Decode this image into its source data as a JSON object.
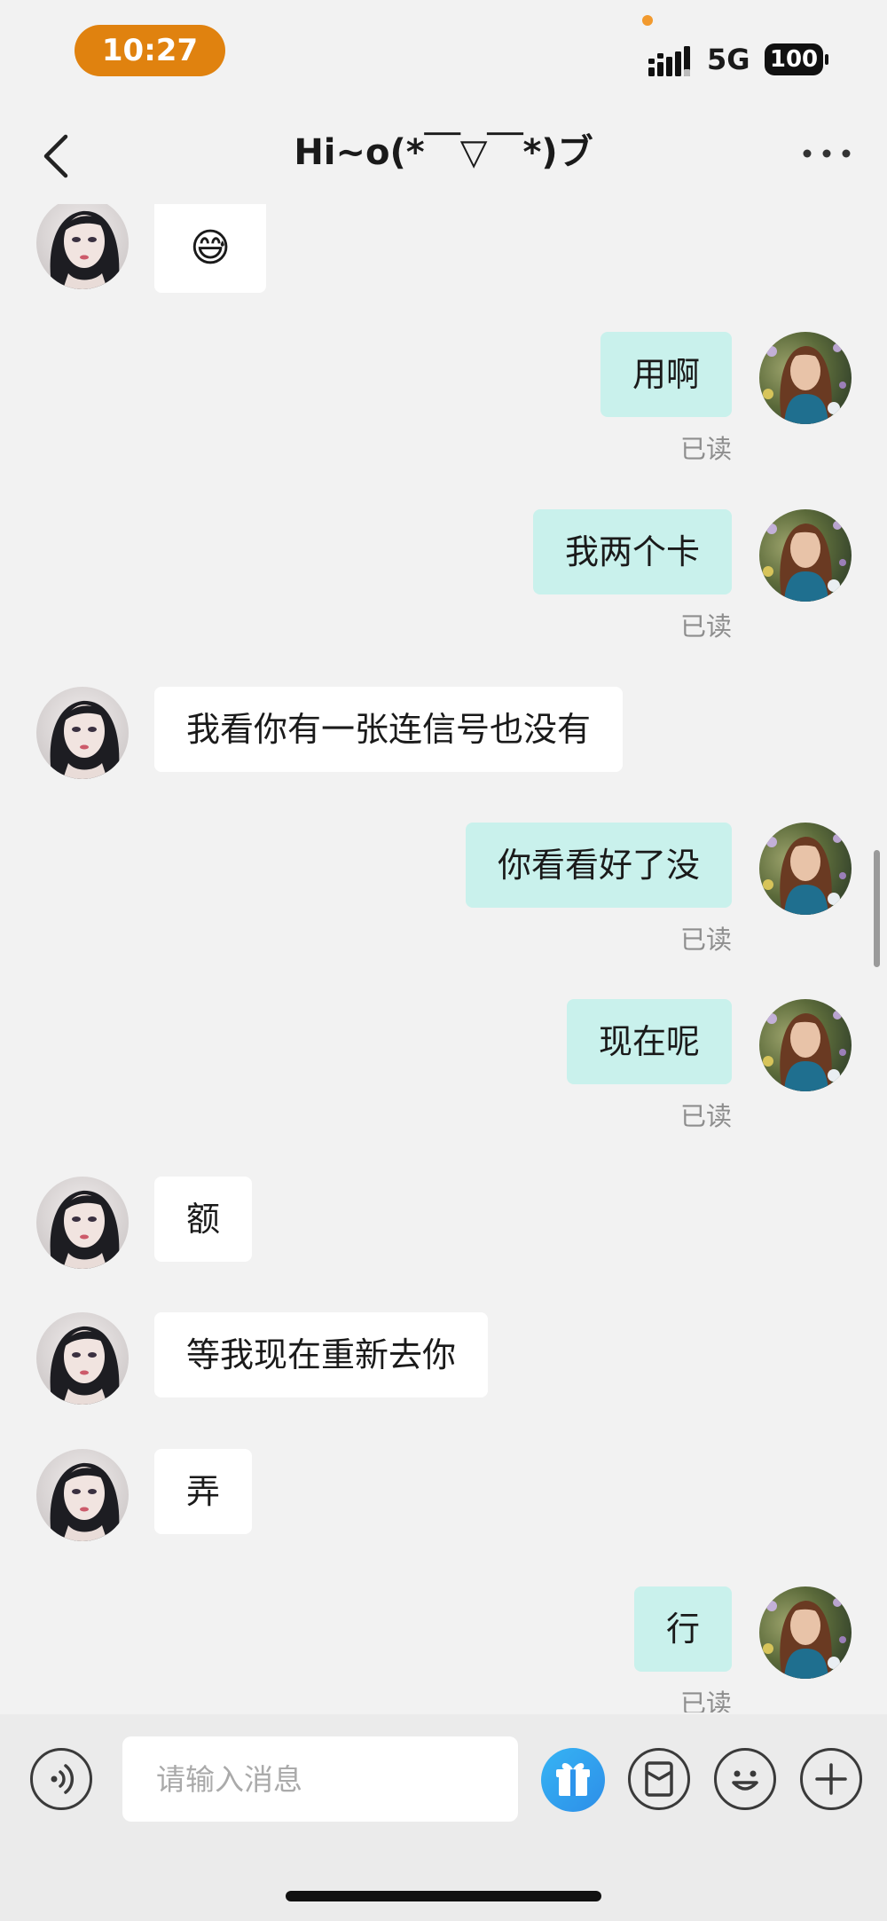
{
  "status_bar": {
    "time": "10:27",
    "network": "5G",
    "battery": "100"
  },
  "header": {
    "title": "Hi~o(*￣▽￣*)ブ"
  },
  "messages": [
    {
      "direction": "in",
      "text": "😅"
    },
    {
      "direction": "out",
      "text": "用啊",
      "status": "已读"
    },
    {
      "direction": "out",
      "text": "我两个卡",
      "status": "已读"
    },
    {
      "direction": "in",
      "text": "我看你有一张连信号也没有"
    },
    {
      "direction": "out",
      "text": "你看看好了没",
      "status": "已读"
    },
    {
      "direction": "out",
      "text": "现在呢",
      "status": "已读"
    },
    {
      "direction": "in",
      "text": "额"
    },
    {
      "direction": "in",
      "text": "等我现在重新去你"
    },
    {
      "direction": "in",
      "text": "弄"
    },
    {
      "direction": "out",
      "text": "行",
      "status": "已读"
    }
  ],
  "input": {
    "placeholder": "请输入消息",
    "value": ""
  },
  "colors": {
    "time_pill": "#e0820f",
    "incoming_bubble": "#ffffff",
    "outgoing_bubble": "#c9f1ec",
    "gift_button": "#2d9bf0",
    "background": "#f2f2f2"
  },
  "icons": [
    "back-icon",
    "more-icon",
    "voice-icon",
    "gift-icon",
    "red-packet-icon",
    "emoji-icon",
    "plus-icon"
  ]
}
